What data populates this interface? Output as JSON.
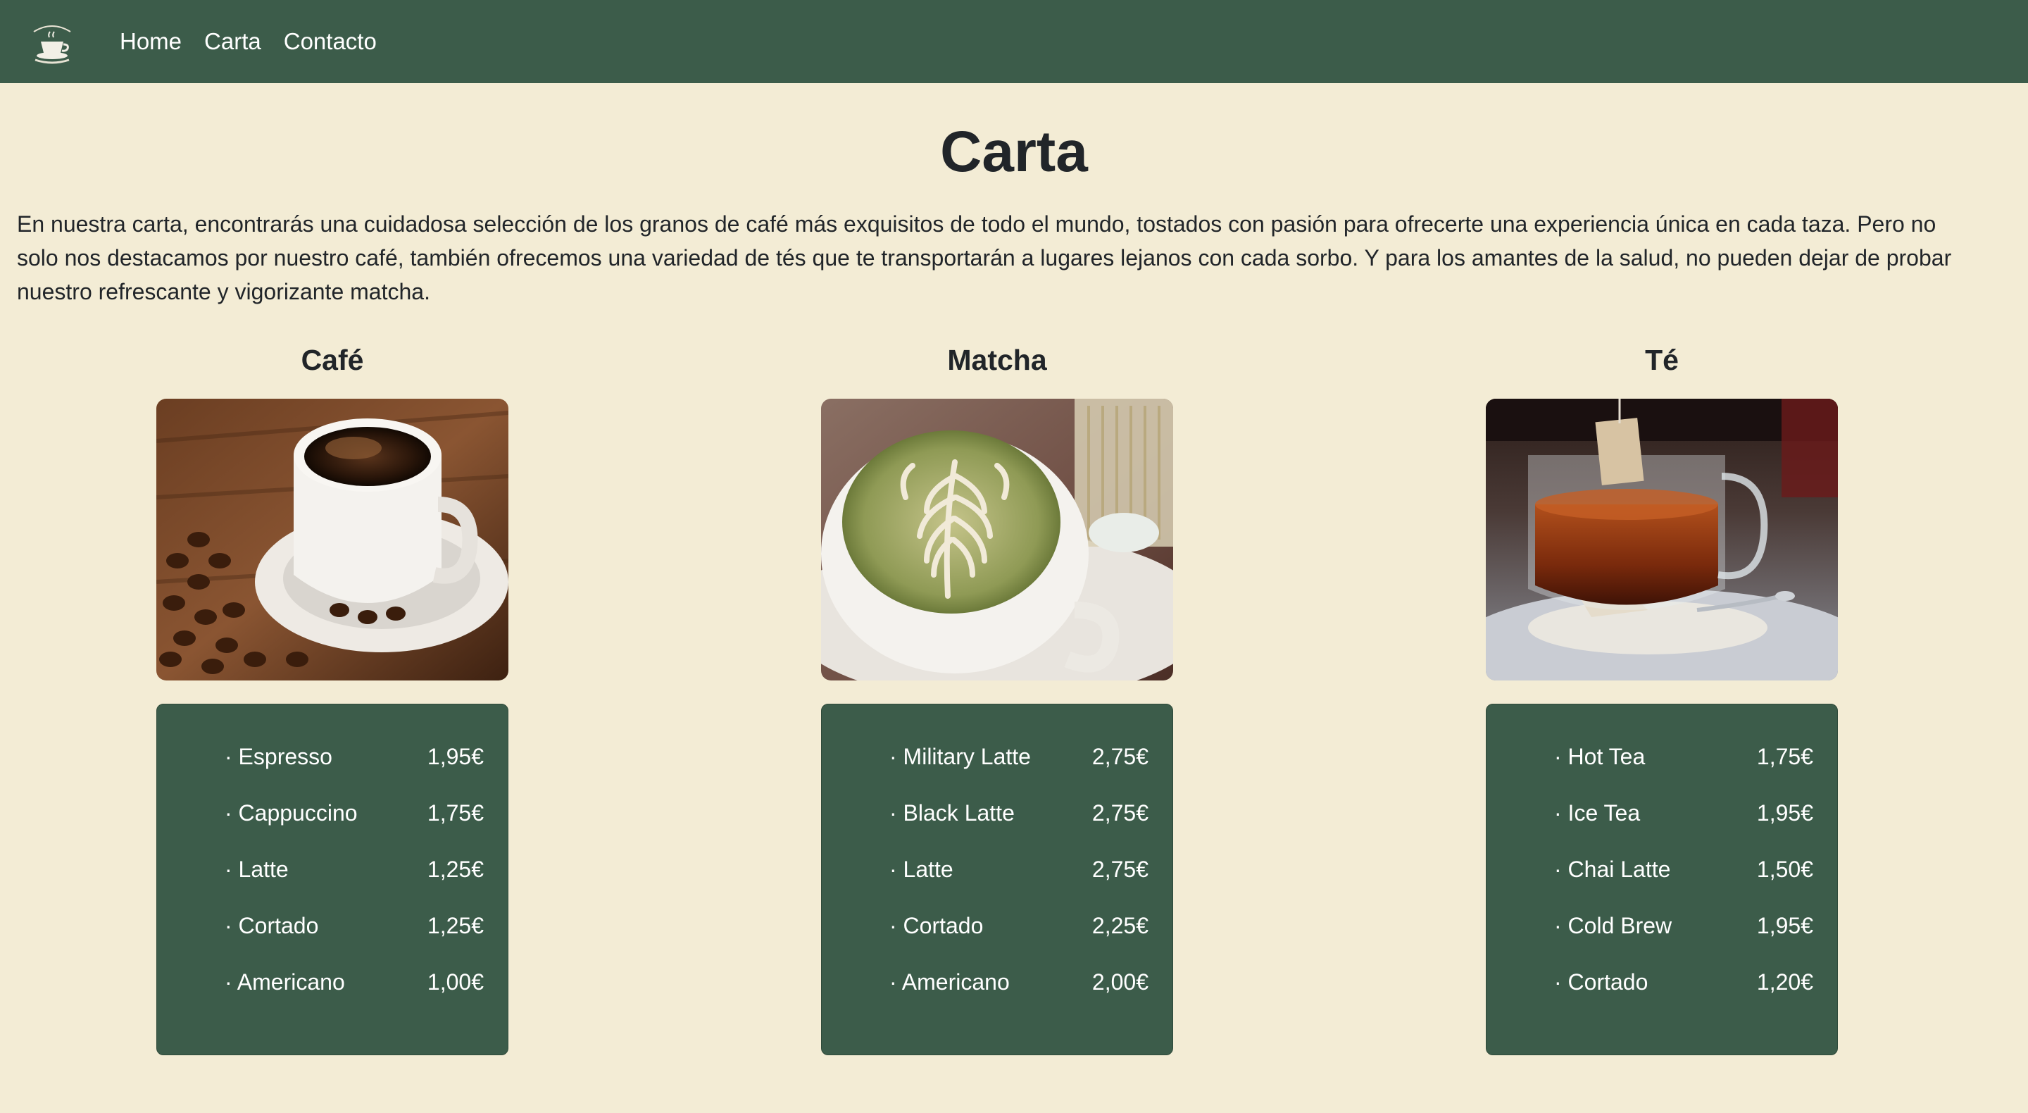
{
  "nav": {
    "logo_alt": "Café Andes logo",
    "links": [
      "Home",
      "Carta",
      "Contacto"
    ]
  },
  "page": {
    "title": "Carta",
    "intro": "En nuestra carta, encontrarás una cuidadosa selección de los granos de café más exquisitos de todo el mundo, tostados con pasión para ofrecerte una experiencia única en cada taza. Pero no solo nos destacamos por nuestro café, también ofrecemos una variedad de tés que te transportarán a lugares lejanos con cada sorbo. Y para los amantes de la salud, no pueden dejar de probar nuestro refrescante y vigorizante matcha."
  },
  "colors": {
    "navbar": "#3c5c4a",
    "background": "#f3ecd5",
    "card": "#3c5c4a"
  },
  "sections": [
    {
      "title": "Café",
      "image": "coffee-cup-with-beans",
      "items": [
        {
          "name": "· Espresso",
          "price": "1,95€"
        },
        {
          "name": "· Cappuccino",
          "price": "1,75€"
        },
        {
          "name": "· Latte",
          "price": "1,25€"
        },
        {
          "name": "· Cortado",
          "price": "1,25€"
        },
        {
          "name": "· Americano",
          "price": "1,00€"
        }
      ]
    },
    {
      "title": "Matcha",
      "image": "matcha-latte-art",
      "items": [
        {
          "name": "· Military Latte",
          "price": "2,75€"
        },
        {
          "name": "· Black Latte",
          "price": "2,75€"
        },
        {
          "name": "· Latte",
          "price": "2,75€"
        },
        {
          "name": "· Cortado",
          "price": "2,25€"
        },
        {
          "name": "· Americano",
          "price": "2,00€"
        }
      ]
    },
    {
      "title": "Té",
      "image": "glass-tea-cup-with-teabag",
      "items": [
        {
          "name": "· Hot Tea",
          "price": "1,75€"
        },
        {
          "name": "· Ice Tea",
          "price": "1,95€"
        },
        {
          "name": "· Chai Latte",
          "price": "1,50€"
        },
        {
          "name": "· Cold Brew",
          "price": "1,95€"
        },
        {
          "name": "· Cortado",
          "price": "1,20€"
        }
      ]
    }
  ]
}
